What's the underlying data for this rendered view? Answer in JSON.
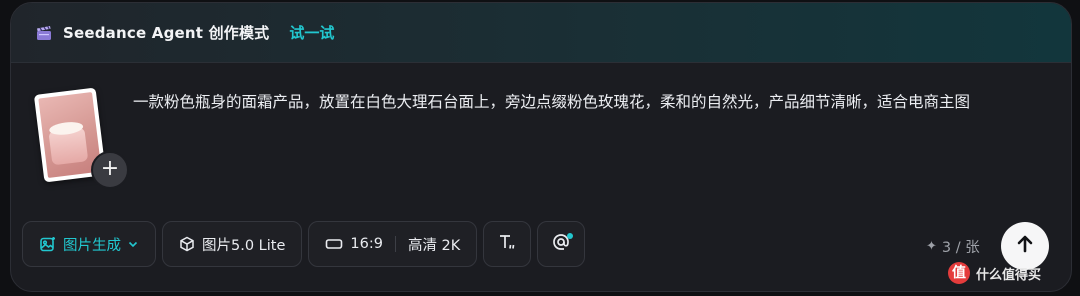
{
  "header": {
    "title": "Seedance Agent 创作模式",
    "try_label": "试一试",
    "icon": "clapperboard-icon"
  },
  "prompt": {
    "text": "一款粉色瓶身的面霜产品，放置在白色大理石台面上，旁边点缀粉色玫瑰花，柔和的自然光，产品细节清晰，适合电商主图"
  },
  "reference_image": {
    "icon": "image-thumbnail",
    "add_label": "+"
  },
  "toolbar": {
    "mode_label": "图片生成",
    "model_label": "图片5.0 Lite",
    "ratio_label": "16:9",
    "quality_label": "高清 2K",
    "text_icon": "text-style-icon",
    "mention_icon": "at-mention-icon"
  },
  "count": {
    "label": "3 / 张"
  },
  "watermark": {
    "logo_text": "值",
    "text": "什么值得买"
  },
  "colors": {
    "accent": "#22c7cf",
    "panel_bg": "#1b1c21",
    "send_bg": "#f6f6f7"
  }
}
